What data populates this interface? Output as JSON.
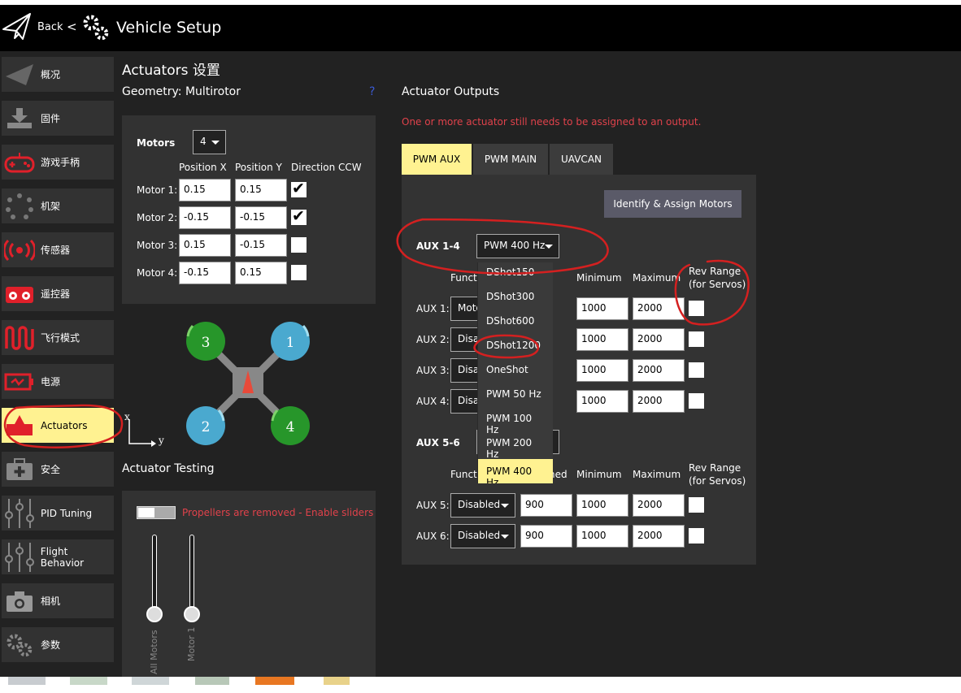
{
  "header": {
    "back_label": "Back",
    "separator": "<",
    "title": "Vehicle Setup"
  },
  "sidebar": {
    "items": [
      {
        "label": "概况",
        "icon": "paper-plane-icon"
      },
      {
        "label": "固件",
        "icon": "download-icon"
      },
      {
        "label": "游戏手柄",
        "icon": "gamepad-icon"
      },
      {
        "label": "机架",
        "icon": "airframe-icon"
      },
      {
        "label": "传感器",
        "icon": "sensors-icon"
      },
      {
        "label": "遥控器",
        "icon": "radio-icon"
      },
      {
        "label": "飞行模式",
        "icon": "flight-modes-icon"
      },
      {
        "label": "电源",
        "icon": "battery-icon"
      },
      {
        "label": "Actuators",
        "icon": "actuators-icon"
      },
      {
        "label": "安全",
        "icon": "safety-icon"
      },
      {
        "label": "PID Tuning",
        "icon": "sliders-icon"
      },
      {
        "label": "Flight Behavior",
        "icon": "sliders-icon"
      },
      {
        "label": "相机",
        "icon": "camera-icon"
      },
      {
        "label": "参数",
        "icon": "gears-icon"
      }
    ]
  },
  "page_title": "Actuators 设置",
  "geometry": {
    "label": "Geometry: Multirotor",
    "help": "?",
    "motors_label": "Motors",
    "motors_value": "4",
    "col_headers": [
      "Position X",
      "Position Y",
      "Direction CCW"
    ],
    "rows": [
      {
        "label": "Motor 1:",
        "x": "0.15",
        "y": "0.15",
        "ccw": true
      },
      {
        "label": "Motor 2:",
        "x": "-0.15",
        "y": "-0.15",
        "ccw": true
      },
      {
        "label": "Motor 3:",
        "x": "0.15",
        "y": "-0.15",
        "ccw": false
      },
      {
        "label": "Motor 4:",
        "x": "-0.15",
        "y": "0.15",
        "ccw": false
      }
    ]
  },
  "diagram": {
    "motor_labels": [
      "3",
      "1",
      "2",
      "4"
    ],
    "axis_x": "x",
    "axis_y": "y"
  },
  "testing": {
    "title": "Actuator Testing",
    "warning": "Propellers are removed - Enable sliders",
    "sliders": [
      "All Motors",
      "Motor 1"
    ]
  },
  "outputs": {
    "title": "Actuator Outputs",
    "warning": "One or more actuator still needs to be assigned to an output.",
    "tabs": [
      "PWM AUX",
      "PWM MAIN",
      "UAVCAN"
    ],
    "identify_button": "Identify & Assign Motors",
    "group1": {
      "label": "AUX 1-4",
      "rate": "PWM 400 Hz",
      "col_headers": [
        "Function",
        "Disarmed",
        "Minimum",
        "Maximum",
        "Rev Range\n(for Servos)"
      ],
      "rows": [
        {
          "label": "AUX 1:",
          "function": "Motor 1",
          "min": "1000",
          "max": "2000"
        },
        {
          "label": "AUX 2:",
          "function": "Disabled",
          "min": "1000",
          "max": "2000"
        },
        {
          "label": "AUX 3:",
          "function": "Disabled",
          "min": "1000",
          "max": "2000"
        },
        {
          "label": "AUX 4:",
          "function": "Disabled",
          "min": "1000",
          "max": "2000"
        }
      ]
    },
    "group2": {
      "label": "AUX 5-6",
      "col_headers": [
        "Function",
        "Disarmed",
        "Minimum",
        "Maximum",
        "Rev Range\n(for Servos)"
      ],
      "rows": [
        {
          "label": "AUX 5:",
          "function": "Disabled",
          "disarmed": "900",
          "min": "1000",
          "max": "2000"
        },
        {
          "label": "AUX 6:",
          "function": "Disabled",
          "disarmed": "900",
          "min": "1000",
          "max": "2000"
        }
      ]
    },
    "dropdown_options": [
      "DShot150",
      "DShot300",
      "DShot600",
      "DShot1200",
      "OneShot",
      "PWM 50 Hz",
      "PWM 100 Hz",
      "PWM 200 Hz",
      "PWM 400 Hz"
    ],
    "dropdown_selected": "PWM 400 Hz"
  },
  "colors": {
    "accent": "#fff291",
    "warning": "#e0424b",
    "annotation": "#d42020",
    "motor_cw": "#4aa9cf",
    "motor_ccw": "#27962a"
  }
}
